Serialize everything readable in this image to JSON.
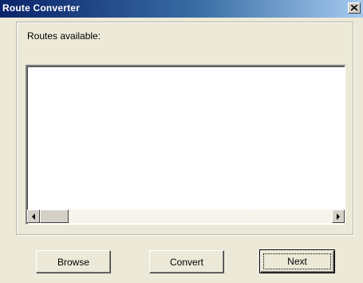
{
  "window": {
    "title": "Route Converter",
    "close_icon": "close-icon"
  },
  "routes": {
    "label": "Routes available:",
    "items": []
  },
  "scrollbar": {
    "left_icon": "arrow-left-icon",
    "right_icon": "arrow-right-icon"
  },
  "buttons": {
    "browse": "Browse",
    "convert": "Convert",
    "next": "Next"
  },
  "colors": {
    "titlebar_start": "#0a246a",
    "titlebar_end": "#a6caf0",
    "dialog_bg": "#ece9d8"
  }
}
